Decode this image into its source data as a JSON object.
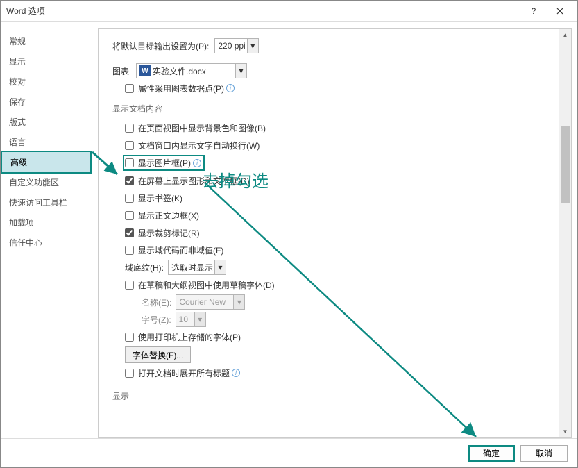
{
  "window": {
    "title": "Word 选项"
  },
  "sidebar": {
    "items": [
      {
        "label": "常规"
      },
      {
        "label": "显示"
      },
      {
        "label": "校对"
      },
      {
        "label": "保存"
      },
      {
        "label": "版式"
      },
      {
        "label": "语言"
      },
      {
        "label": "高级",
        "selected": true
      },
      {
        "label": "自定义功能区"
      },
      {
        "label": "快速访问工具栏"
      },
      {
        "label": "加载项"
      },
      {
        "label": "信任中心"
      }
    ]
  },
  "top": {
    "default_target_label": "将默认目标输出设置为(P):",
    "default_target_value": "220 ppi",
    "chart_label": "图表",
    "chart_doc": "实验文件.docx",
    "chart_attr_label": "属性采用图表数据点(P)"
  },
  "sec1": {
    "title": "显示文档内容"
  },
  "opts": {
    "bg": "在页面视图中显示背景色和图像(B)",
    "wrap": "文档窗口内显示文字自动换行(W)",
    "picframe": "显示图片框(P)",
    "drawings": "在屏幕上显示图形和文本框(D)",
    "bookmarks": "显示书签(K)",
    "textbound": "显示正文边框(X)",
    "cropmarks": "显示裁剪标记(R)",
    "fieldcodes": "显示域代码而非域值(F)",
    "shading_label": "域底纹(H):",
    "shading_value": "选取时显示",
    "draftfont": "在草稿和大纲视图中使用草稿字体(D)",
    "name_label": "名称(E):",
    "name_value": "Courier New",
    "size_label": "字号(Z):",
    "size_value": "10",
    "printer_fonts": "使用打印机上存储的字体(P)",
    "font_subst_btn": "字体替换(F)...",
    "expand_headings": "打开文档时展开所有标题"
  },
  "sec2": {
    "title": "显示"
  },
  "footer": {
    "ok": "确定",
    "cancel": "取消"
  },
  "annotation": {
    "text": "去掉勾选"
  }
}
